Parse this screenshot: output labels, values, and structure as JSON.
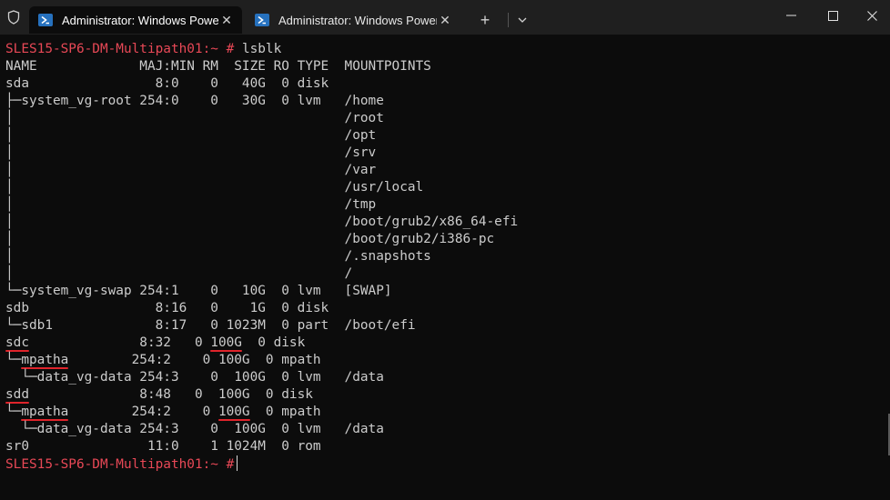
{
  "tabs": [
    {
      "title": "Administrator: Windows PowerShell",
      "active": true
    },
    {
      "title": "Administrator: Windows PowerShell",
      "active": false
    }
  ],
  "colors": {
    "prompt": "#e74856",
    "text": "#cccccc",
    "background": "#0c0c0c",
    "underline": "#e0242b"
  },
  "icons": {
    "shield": "shield-icon",
    "tab": "powershell-icon",
    "close": "close-icon",
    "new_tab": "plus-icon",
    "dropdown": "chevron-down-icon",
    "minimize": "minimize-icon",
    "maximize": "maximize-icon",
    "window_close": "close-icon"
  },
  "terminal": {
    "prompt": "SLES15-SP6-DM-Multipath01:~ #",
    "command": "lsblk",
    "header": "NAME             MAJ:MIN RM  SIZE RO TYPE  MOUNTPOINTS",
    "lines": [
      "sda                8:0    0   40G  0 disk",
      "├─system_vg-root 254:0    0   30G  0 lvm   /home",
      "│                                          /root",
      "│                                          /opt",
      "│                                          /srv",
      "│                                          /var",
      "│                                          /usr/local",
      "│                                          /tmp",
      "│                                          /boot/grub2/x86_64-efi",
      "│                                          /boot/grub2/i386-pc",
      "│                                          /.snapshots",
      "│                                          /",
      "└─system_vg-swap 254:1    0   10G  0 lvm   [SWAP]",
      "sdb                8:16   0    1G  0 disk",
      "└─sdb1             8:17   0 1023M  0 part  /boot/efi"
    ],
    "mp_blocks": [
      {
        "disk_name": "sdc",
        "disk_rest": "              8:32   0 ",
        "disk_size": "100G",
        "disk_tail": "  0 disk",
        "mp_prefix": "└─",
        "mp_name": "mpatha",
        "mp_rest": "        254:2    0 ",
        "mp_size": "100G",
        "mp_tail": "  0 mpath",
        "lv_line": "  └─data_vg-data 254:3    0  100G  0 lvm   /data"
      },
      {
        "disk_name": "sdd",
        "disk_rest": "              8:48   0  100G  0 disk",
        "mp_prefix": "└─",
        "mp_name": "mpatha",
        "mp_rest": "        254:2    0 ",
        "mp_size": "100G",
        "mp_tail": "  0 mpath",
        "lv_line": "  └─data_vg-data 254:3    0  100G  0 lvm   /data"
      }
    ],
    "last_line": "sr0               11:0    1 1024M  0 rom"
  }
}
